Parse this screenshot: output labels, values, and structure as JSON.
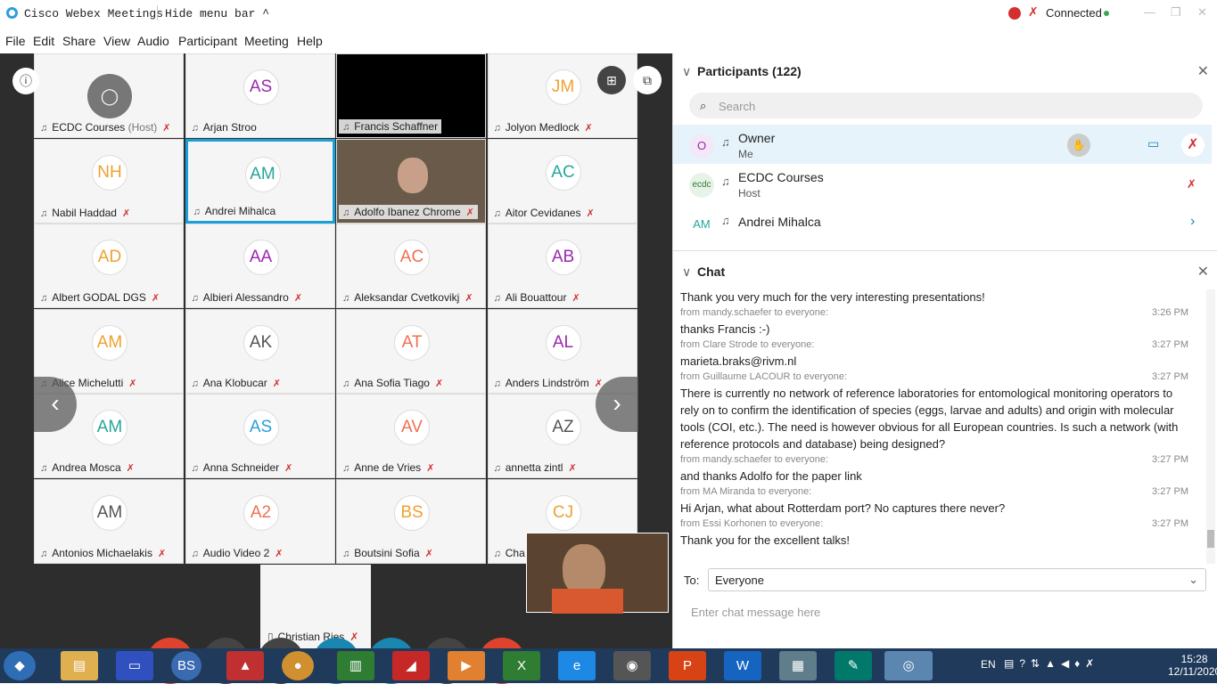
{
  "app": {
    "title": "Cisco Webex Meetings",
    "hide_menu": "Hide menu bar",
    "status": "Connected"
  },
  "menu": [
    "File",
    "Edit",
    "Share",
    "View",
    "Audio",
    "Participant",
    "Meeting",
    "Help"
  ],
  "tiles": [
    {
      "ini": "",
      "name": "ECDC Courses",
      "host": "(Host)",
      "muted": true,
      "color": "#888"
    },
    {
      "ini": "AS",
      "name": "Arjan Stroo",
      "muted": false,
      "color": "#9c27b0"
    },
    {
      "ini": "",
      "name": "Francis Schaffner",
      "muted": false,
      "video": true,
      "color": "#000"
    },
    {
      "ini": "JM",
      "name": "Jolyon Medlock",
      "muted": true,
      "color": "#f0a030"
    },
    {
      "ini": "NH",
      "name": "Nabil Haddad",
      "muted": true,
      "color": "#f0a030"
    },
    {
      "ini": "AM",
      "name": "Andrei Mihalca",
      "muted": false,
      "active": true,
      "color": "#26a69a"
    },
    {
      "ini": "",
      "name": "Adolfo Ibanez Chrome",
      "muted": true,
      "video": true,
      "color": "#000"
    },
    {
      "ini": "AC",
      "name": "Aitor Cevidanes",
      "muted": true,
      "color": "#26a69a"
    },
    {
      "ini": "AD",
      "name": "Albert GODAL DGS",
      "muted": true,
      "color": "#f0a030"
    },
    {
      "ini": "AA",
      "name": "Albieri Alessandro",
      "muted": true,
      "color": "#9c27b0"
    },
    {
      "ini": "AC",
      "name": "Aleksandar Cvetkovikj",
      "muted": true,
      "color": "#f07050"
    },
    {
      "ini": "AB",
      "name": "Ali Bouattour",
      "muted": true,
      "color": "#9c27b0"
    },
    {
      "ini": "AM",
      "name": "Alice Michelutti",
      "muted": true,
      "color": "#f0a030"
    },
    {
      "ini": "AK",
      "name": "Ana Klobucar",
      "muted": true,
      "color": "#555"
    },
    {
      "ini": "AT",
      "name": "Ana Sofia Tiago",
      "muted": true,
      "color": "#f07050"
    },
    {
      "ini": "AL",
      "name": "Anders Lindström",
      "muted": true,
      "color": "#9c27b0"
    },
    {
      "ini": "AM",
      "name": "Andrea Mosca",
      "muted": true,
      "color": "#26a69a"
    },
    {
      "ini": "AS",
      "name": "Anna Schneider",
      "muted": true,
      "color": "#29a0d8"
    },
    {
      "ini": "AV",
      "name": "Anne de Vries",
      "muted": true,
      "color": "#f07050"
    },
    {
      "ini": "AZ",
      "name": "annetta zintl",
      "muted": true,
      "color": "#555"
    },
    {
      "ini": "AM",
      "name": "Antonios Michaelakis",
      "muted": true,
      "color": "#555"
    },
    {
      "ini": "A2",
      "name": "Audio Video 2",
      "muted": true,
      "color": "#f07050"
    },
    {
      "ini": "BS",
      "name": "Boutsini Sofia",
      "muted": true,
      "color": "#f0a030"
    },
    {
      "ini": "CJ",
      "name": "Cha",
      "muted": false,
      "color": "#f0a030"
    }
  ],
  "bottom_tile": {
    "name": "Christian Ries"
  },
  "participants": {
    "title": "Participants (122)",
    "search_placeholder": "Search",
    "rows": [
      {
        "ini": "O",
        "name": "Owner",
        "role": "Me"
      },
      {
        "ini": "",
        "name": "ECDC Courses",
        "role": "Host"
      },
      {
        "ini": "AM",
        "name": "Andrei Mihalca",
        "role": ""
      }
    ]
  },
  "chat": {
    "title": "Chat",
    "to_label": "To:",
    "to_value": "Everyone",
    "input_placeholder": "Enter chat message here",
    "messages": [
      {
        "from": "",
        "time": "",
        "text": "Thank you very much for the very interesting presentations!"
      },
      {
        "from": "from mandy.schaefer to everyone:",
        "time": "3:26 PM",
        "text": "thanks Francis :-)"
      },
      {
        "from": "from Clare Strode to everyone:",
        "time": "3:27 PM",
        "text": "marieta.braks@rivm.nl"
      },
      {
        "from": "from Guillaume LACOUR to everyone:",
        "time": "3:27 PM",
        "text": "There is currently no network of reference laboratories for entomological monitoring operators to rely on to confirm the identification of species (eggs, larvae and adults) and origin with molecular tools (COI, etc.). The need is however obvious for all European countries. Is such a network (with reference protocols and database) being designed?"
      },
      {
        "from": "from mandy.schaefer to everyone:",
        "time": "3:27 PM",
        "text": "and thanks Adolfo for the paper link"
      },
      {
        "from": "from MA Miranda to everyone:",
        "time": "3:27 PM",
        "text": "Hi Arjan, what about Rotterdam port? No captures there never?"
      },
      {
        "from": "from Essi Korhonen to everyone:",
        "time": "3:27 PM",
        "text": "Thank you for the excellent talks!"
      }
    ]
  },
  "taskbar": {
    "lang": "EN",
    "time": "15:28",
    "date": "12/11/2020"
  }
}
